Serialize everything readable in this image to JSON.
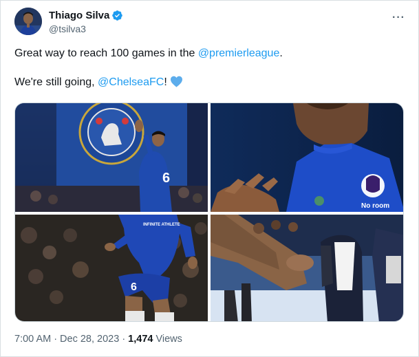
{
  "author": {
    "display_name": "Thiago Silva",
    "handle": "@tsilva3",
    "avatar_icon": "profile-photo-icon",
    "verified_icon": "verified-badge-icon",
    "verified_color": "#1d9bf0"
  },
  "more_icon_glyph": "···",
  "tweet": {
    "line1_prefix": "Great way to reach 100 games in the ",
    "line1_mention": "@premierleague",
    "line1_suffix": ".",
    "line2_prefix": "We're still going, ",
    "line2_mention": "@ChelseaFC",
    "line2_suffix": "!",
    "emoji_icon": "blue-heart-icon",
    "mention_color": "#1d9bf0"
  },
  "media": {
    "photo1_shirt_number": "6",
    "photo3_shirt_number": "6",
    "photo2_sponsor": "No room",
    "photo3_sleeve_text": "INFINITE ATHLETE"
  },
  "meta": {
    "time": "7:00 AM",
    "separator1": "·",
    "date": "Dec 28, 2023",
    "separator2": "·",
    "views_count": "1,474",
    "views_label": "Views"
  }
}
